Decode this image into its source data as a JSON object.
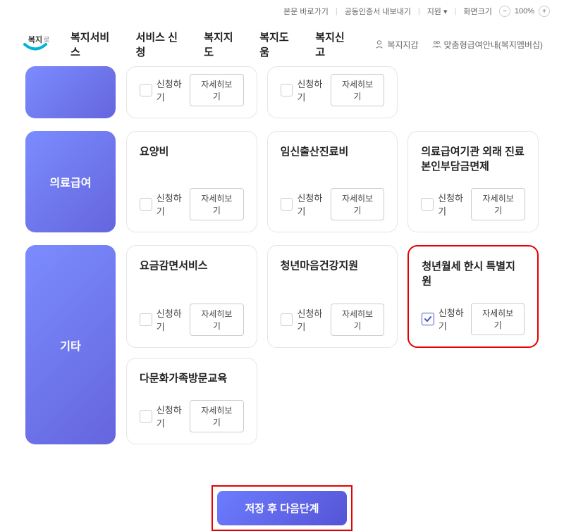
{
  "topbar": {
    "skip": "본문 바로가기",
    "cert": "공동인증서 내보내기",
    "support": "지원",
    "zoom_label": "화면크기",
    "zoom_value": "100%"
  },
  "header": {
    "logo_text": "복지로",
    "nav": [
      "복지서비스",
      "서비스 신청",
      "복지지도",
      "복지도움",
      "복지신고"
    ],
    "right": {
      "wallet": "복지지갑",
      "guide": "맞춤형급여안내(복지멤버십)"
    }
  },
  "labels": {
    "apply": "신청하기",
    "detail": "자세히보기"
  },
  "sections": [
    {
      "category": "",
      "partial": true,
      "cards": [
        {
          "title": "",
          "checked": false
        },
        {
          "title": "",
          "checked": false
        }
      ]
    },
    {
      "category": "의료급여",
      "cards": [
        {
          "title": "요양비",
          "checked": false
        },
        {
          "title": "임신출산진료비",
          "checked": false
        },
        {
          "title": "의료급여기관 외래 진료 본인부담금면제",
          "checked": false
        }
      ]
    },
    {
      "category": "기타",
      "cards": [
        {
          "title": "요금감면서비스",
          "checked": false
        },
        {
          "title": "청년마음건강지원",
          "checked": false
        },
        {
          "title": "청년월세 한시 특별지원",
          "checked": true,
          "highlighted": true
        },
        {
          "title": "다문화가족방문교육",
          "checked": false
        }
      ]
    }
  ],
  "bottom": {
    "save": "저장 후 다음단계"
  }
}
